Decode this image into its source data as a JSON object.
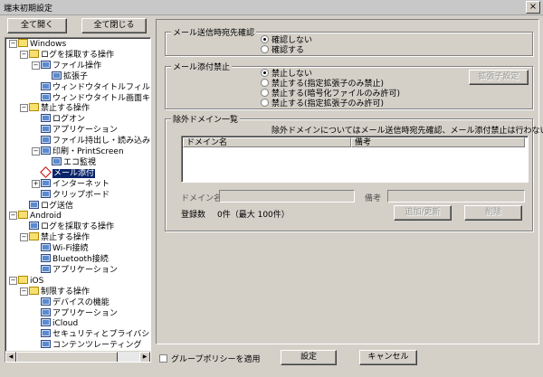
{
  "window": {
    "title": "端末初期設定",
    "close_glyph": "×"
  },
  "toolbar": {
    "expand_all": "全て開く",
    "collapse_all": "全て閉じる"
  },
  "tree": [
    {
      "label": "Windows",
      "depth": 0,
      "expander": "−",
      "icon": "folder-icon"
    },
    {
      "label": "ログを採取する操作",
      "depth": 1,
      "expander": "−",
      "icon": "folder-icon"
    },
    {
      "label": "ファイル操作",
      "depth": 2,
      "expander": "−",
      "icon": "monitor-icon"
    },
    {
      "label": "拡張子",
      "depth": 3,
      "expander": "",
      "icon": "monitor-icon"
    },
    {
      "label": "ウィンドウタイトルフィルタ",
      "depth": 2,
      "expander": "",
      "icon": "monitor-icon"
    },
    {
      "label": "ウィンドウタイトル画面キャ",
      "depth": 2,
      "expander": "",
      "icon": "monitor-icon"
    },
    {
      "label": "禁止する操作",
      "depth": 1,
      "expander": "−",
      "icon": "folder-icon"
    },
    {
      "label": "ログオン",
      "depth": 2,
      "expander": "",
      "icon": "monitor-icon"
    },
    {
      "label": "アプリケーション",
      "depth": 2,
      "expander": "",
      "icon": "monitor-icon"
    },
    {
      "label": "ファイル持出し・読み込み",
      "depth": 2,
      "expander": "",
      "icon": "monitor-icon"
    },
    {
      "label": "印刷・PrintScreen",
      "depth": 2,
      "expander": "−",
      "icon": "monitor-icon"
    },
    {
      "label": "エコ監視",
      "depth": 3,
      "expander": "",
      "icon": "monitor-icon"
    },
    {
      "label": "メール添付",
      "depth": 2,
      "expander": "",
      "icon": "diamond-icon",
      "selected": true
    },
    {
      "label": "インターネット",
      "depth": 2,
      "expander": "+",
      "icon": "monitor-icon"
    },
    {
      "label": "クリップボード",
      "depth": 2,
      "expander": "",
      "icon": "monitor-icon"
    },
    {
      "label": "ログ送信",
      "depth": 1,
      "expander": "",
      "icon": "monitor-icon"
    },
    {
      "label": "Android",
      "depth": 0,
      "expander": "−",
      "icon": "folder-icon"
    },
    {
      "label": "ログを採取する操作",
      "depth": 1,
      "expander": "",
      "icon": "monitor-icon"
    },
    {
      "label": "禁止する操作",
      "depth": 1,
      "expander": "−",
      "icon": "folder-icon"
    },
    {
      "label": "Wi-Fi接続",
      "depth": 2,
      "expander": "",
      "icon": "monitor-icon"
    },
    {
      "label": "Bluetooth接続",
      "depth": 2,
      "expander": "",
      "icon": "monitor-icon"
    },
    {
      "label": "アプリケーション",
      "depth": 2,
      "expander": "",
      "icon": "monitor-icon"
    },
    {
      "label": "iOS",
      "depth": 0,
      "expander": "−",
      "icon": "folder-icon"
    },
    {
      "label": "制限する操作",
      "depth": 1,
      "expander": "−",
      "icon": "folder-icon"
    },
    {
      "label": "デバイスの機能",
      "depth": 2,
      "expander": "",
      "icon": "monitor-icon"
    },
    {
      "label": "アプリケーション",
      "depth": 2,
      "expander": "",
      "icon": "monitor-icon"
    },
    {
      "label": "iCloud",
      "depth": 2,
      "expander": "",
      "icon": "monitor-icon"
    },
    {
      "label": "セキュリティとプライバシー",
      "depth": 2,
      "expander": "",
      "icon": "monitor-icon"
    },
    {
      "label": "コンテンツレーティング",
      "depth": 2,
      "expander": "",
      "icon": "monitor-icon"
    }
  ],
  "confirm_group": {
    "title": "メール送信時宛先確認",
    "options": [
      {
        "label": "確認しない",
        "checked": true
      },
      {
        "label": "確認する",
        "checked": false
      }
    ]
  },
  "attach_group": {
    "title": "メール添付禁止",
    "options": [
      {
        "label": "禁止しない",
        "checked": true
      },
      {
        "label": "禁止する(指定拡張子のみ禁止)",
        "checked": false
      },
      {
        "label": "禁止する(暗号化ファイルのみ許可)",
        "checked": false
      },
      {
        "label": "禁止する(指定拡張子のみ許可)",
        "checked": false
      }
    ],
    "ext_button": "拡張子設定"
  },
  "exclude_group": {
    "title": "除外ドメイン一覧",
    "note": "除外ドメインについてはメール送信時宛先確認、メール添付禁止は行わない",
    "columns": [
      "ドメイン名",
      "備考"
    ],
    "domain_label": "ドメイン名",
    "remarks_label": "備考",
    "count_label": "登録数",
    "count_value": "0件（最大 100件）",
    "add_update": "追加/更新",
    "delete": "削除"
  },
  "footer": {
    "gpo_checkbox": "グループポリシーを適用",
    "ok": "設定",
    "cancel": "キャンセル"
  },
  "icons": {
    "scroll_left": "◀",
    "scroll_right": "▶"
  }
}
